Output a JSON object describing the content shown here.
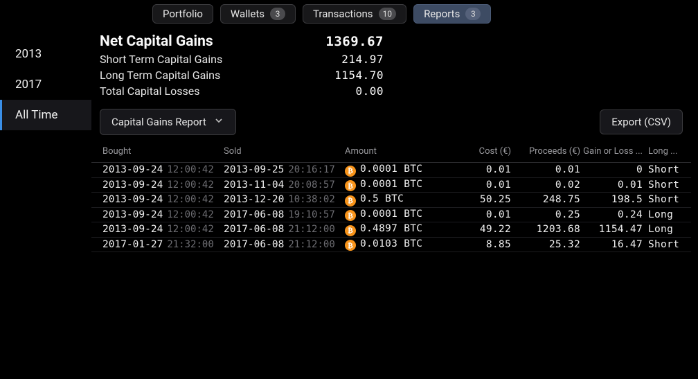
{
  "tabs": [
    {
      "label": "Portfolio",
      "badge": null,
      "active": false
    },
    {
      "label": "Wallets",
      "badge": "3",
      "active": false
    },
    {
      "label": "Transactions",
      "badge": "10",
      "active": false
    },
    {
      "label": "Reports",
      "badge": "3",
      "active": true
    }
  ],
  "sidebar": {
    "items": [
      {
        "label": "2013",
        "active": false
      },
      {
        "label": "2017",
        "active": false
      },
      {
        "label": "All Time",
        "active": true
      }
    ]
  },
  "summary": {
    "header_label": "Net Capital Gains",
    "header_value": "1369.67",
    "rows": [
      {
        "label": "Short Term Capital Gains",
        "value": "214.97"
      },
      {
        "label": "Long Term Capital Gains",
        "value": "1154.70"
      },
      {
        "label": "Total Capital Losses",
        "value": "0.00"
      }
    ]
  },
  "toolbar": {
    "report_selector": "Capital Gains Report",
    "export_label": "Export (CSV)"
  },
  "table": {
    "headers": {
      "bought": "Bought",
      "sold": "Sold",
      "amount": "Amount",
      "cost": "Cost (€)",
      "proceeds": "Proceeds (€)",
      "gl": "Gain or Loss ...",
      "term": "Long ..."
    },
    "rows": [
      {
        "bought_date": "2013-09-24",
        "bought_time": "12:00:42",
        "sold_date": "2013-09-25",
        "sold_time": "20:16:17",
        "coin": "BTC",
        "amount": "0.0001",
        "cost": "0.01",
        "proceeds": "0.01",
        "gl": "0",
        "term": "Short"
      },
      {
        "bought_date": "2013-09-24",
        "bought_time": "12:00:42",
        "sold_date": "2013-11-04",
        "sold_time": "20:08:57",
        "coin": "BTC",
        "amount": "0.0001",
        "cost": "0.01",
        "proceeds": "0.02",
        "gl": "0.01",
        "term": "Short"
      },
      {
        "bought_date": "2013-09-24",
        "bought_time": "12:00:42",
        "sold_date": "2013-12-20",
        "sold_time": "10:38:02",
        "coin": "BTC",
        "amount": "0.5",
        "cost": "50.25",
        "proceeds": "248.75",
        "gl": "198.5",
        "term": "Short"
      },
      {
        "bought_date": "2013-09-24",
        "bought_time": "12:00:42",
        "sold_date": "2017-06-08",
        "sold_time": "19:10:57",
        "coin": "BTC",
        "amount": "0.0001",
        "cost": "0.01",
        "proceeds": "0.25",
        "gl": "0.24",
        "term": "Long"
      },
      {
        "bought_date": "2013-09-24",
        "bought_time": "12:00:42",
        "sold_date": "2017-06-08",
        "sold_time": "21:12:00",
        "coin": "BTC",
        "amount": "0.4897",
        "cost": "49.22",
        "proceeds": "1203.68",
        "gl": "1154.47",
        "term": "Long"
      },
      {
        "bought_date": "2017-01-27",
        "bought_time": "21:32:00",
        "sold_date": "2017-06-08",
        "sold_time": "21:12:00",
        "coin": "BTC",
        "amount": "0.0103",
        "cost": "8.85",
        "proceeds": "25.32",
        "gl": "16.47",
        "term": "Short"
      }
    ]
  }
}
